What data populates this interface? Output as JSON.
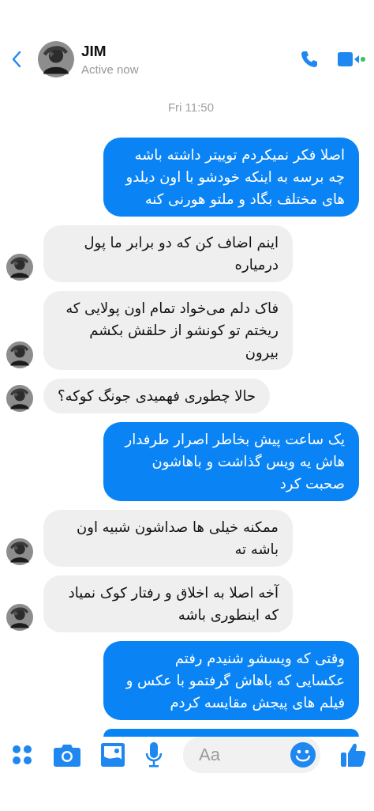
{
  "header": {
    "contact_name": "JIM",
    "status": "Active now"
  },
  "timestamp": "Fri 11:50",
  "messages": [
    {
      "outgoing": true,
      "kind": "text",
      "text": "اصلا فکر نمیکردم توییتر داشته باشه چه برسه به اینکه خودشو با اون دیلدو های مختلف بگاد و ملتو هورنی کنه"
    },
    {
      "outgoing": false,
      "kind": "text",
      "text": "اینم اضاف کن که دو برابر ما پول درمیاره"
    },
    {
      "outgoing": false,
      "kind": "text",
      "text": "فاک دلم می‌خواد تمام اون پولایی که ریختم تو کونشو از حلقش بکشم بیرون"
    },
    {
      "outgoing": false,
      "kind": "text",
      "text": "حالا چطوری فهمیدی جونگ کوکه؟"
    },
    {
      "outgoing": true,
      "kind": "text",
      "text": "یک ساعت پیش بخاطر اصرار طرفدار هاش یه ویس گذاشت و باهاشون صحبت کرد"
    },
    {
      "outgoing": false,
      "kind": "text",
      "text": "ممکنه خیلی ها صداشون شبیه اون باشه ته"
    },
    {
      "outgoing": false,
      "kind": "text",
      "text": "آخه اصلا به اخلاق و رفتار کوک نمیاد که اینطوری باشه"
    },
    {
      "outgoing": true,
      "kind": "text",
      "text": "وقتی که ویسشو شنیدم رفتم عکسایی که باهاش گرفتمو با عکس و فیلم های پیجش مقایسه کردم"
    },
    {
      "outgoing": true,
      "kind": "clipped"
    }
  ],
  "composer": {
    "placeholder": "Aa"
  }
}
